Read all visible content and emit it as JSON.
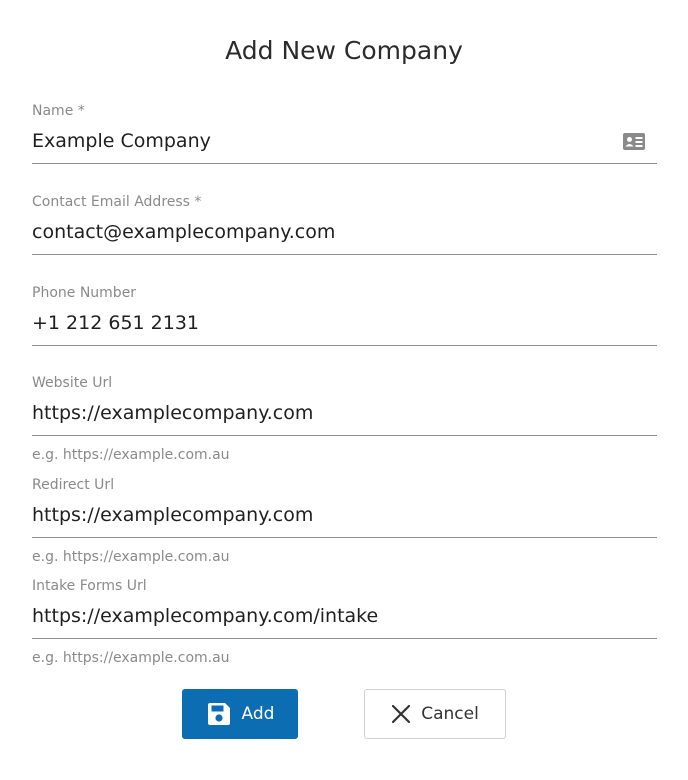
{
  "dialog": {
    "title": "Add New Company"
  },
  "fields": [
    {
      "label": "Name *",
      "value": "Example Company",
      "hint": ""
    },
    {
      "label": "Contact Email Address *",
      "value": "contact@examplecompany.com",
      "hint": ""
    },
    {
      "label": "Phone Number",
      "value": "+1 212 651 2131",
      "hint": ""
    },
    {
      "label": "Website Url",
      "value": "https://examplecompany.com",
      "hint": "e.g. https://example.com.au"
    },
    {
      "label": "Redirect Url",
      "value": "https://examplecompany.com",
      "hint": "e.g. https://example.com.au"
    },
    {
      "label": "Intake Forms Url",
      "value": "https://examplecompany.com/intake",
      "hint": "e.g. https://example.com.au"
    }
  ],
  "icons": {
    "name_field": "contact-card-icon",
    "add_button": "save-floppy-icon",
    "cancel_button": "close-x-icon"
  },
  "buttons": {
    "add_label": "Add",
    "cancel_label": "Cancel"
  },
  "colors": {
    "primary": "#0d6db3",
    "underline": "#8f8f8f",
    "label": "#8a8a8a"
  }
}
